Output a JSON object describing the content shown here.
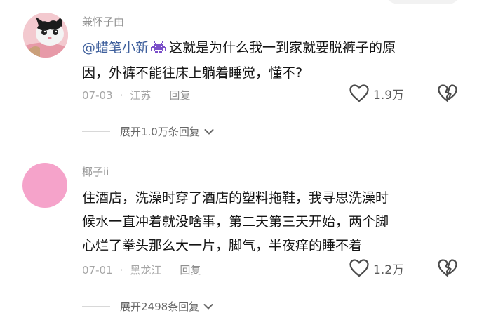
{
  "comments": [
    {
      "username": "兼怀子由",
      "mention": "@蜡笔小新",
      "text_line1": "这就是为什么我一到家就要脱裤子的原",
      "text_line2": "因，外裤不能往床上躺着睡觉，懂不?",
      "date": "07-03",
      "location": "江苏",
      "reply_label": "回复",
      "likes": "1.9万",
      "expand_label": "展开1.0万条回复"
    },
    {
      "username": "椰子ii",
      "text_line1": "住酒店，洗澡时穿了酒店的塑料拖鞋，我寻思洗澡时",
      "text_line2": "候水一直冲着就没啥事，第二天第三天开始，两个脚",
      "text_line3": "心烂了拳头那么大一片，脚气，半夜痒的睡不着",
      "date": "07-01",
      "location": "黑龙江",
      "reply_label": "回复",
      "likes": "1.2万",
      "expand_label": "展开2498条回复"
    }
  ],
  "colors": {
    "mention": "#3e5f9c",
    "avatar2": "#f5a3ca",
    "meta": "#a6a6a6"
  },
  "icons": [
    "heart-outline-icon",
    "broken-heart-icon",
    "chevron-down-icon",
    "space-invader-emoji-icon"
  ]
}
